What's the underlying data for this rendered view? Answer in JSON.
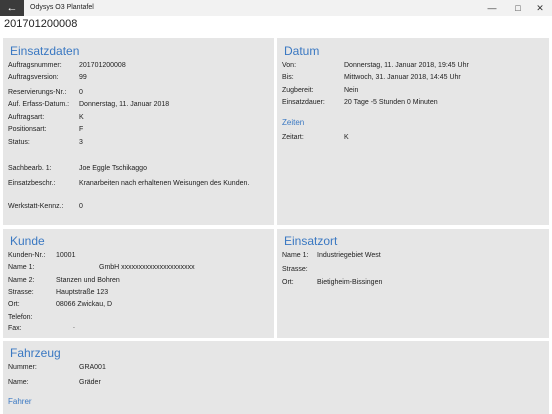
{
  "window": {
    "app_title": "Odysys O3 Plantafel",
    "back_icon": "arrow-left-icon",
    "minimize_glyph": "—",
    "maximize_glyph": "□",
    "close_glyph": "✕"
  },
  "header": {
    "title": "201701200008"
  },
  "einsatzdaten": {
    "title": "Einsatzdaten",
    "rows": [
      {
        "label": "Auftragsnummer:",
        "value": "201701200008"
      },
      {
        "label": "Auftragsversion:",
        "value": "99"
      },
      {
        "label": "Reservierungs-Nr.:",
        "value": "0"
      },
      {
        "label": "Auf. Erfass-Datum.:",
        "value": "Donnerstag, 11. Januar 2018"
      },
      {
        "label": "Auftragsart:",
        "value": "K"
      },
      {
        "label": "Positionsart:",
        "value": "F"
      },
      {
        "label": "Status:",
        "value": "3"
      },
      {
        "label": "Sachbearb. 1:",
        "value": "Joe Eggle Tschikaggo"
      },
      {
        "label": "Einsatzbeschr.:",
        "value": "Kranarbeiten nach erhaltenen Weisungen des Kunden."
      },
      {
        "label": "Werkstatt-Kennz.:",
        "value": "0"
      }
    ]
  },
  "datum": {
    "title": "Datum",
    "rows": [
      {
        "label": "Von:",
        "value": "Donnerstag, 11. Januar 2018, 19:45 Uhr"
      },
      {
        "label": "Bis:",
        "value": "Mittwoch, 31. Januar 2018, 14:45 Uhr"
      },
      {
        "label": "Zugbereit:",
        "value": "Nein"
      },
      {
        "label": "Einsatzdauer:",
        "value": "20 Tage -5 Stunden 0 Minuten"
      }
    ],
    "zeiten_title": "Zeiten",
    "zeitart_label": "Zeitart:",
    "zeitart_value": "K"
  },
  "kunde": {
    "title": "Kunde",
    "rows": [
      {
        "label": "Kunden-Nr.:",
        "value": "10001"
      },
      {
        "label": "Name 1:",
        "value": "GmbH xxxxxxxxxxxxxxxxxxxxx"
      },
      {
        "label": "Name 2:",
        "value": "Stanzen und Bohren"
      },
      {
        "label": "Strasse:",
        "value": "Hauptstraße 123"
      },
      {
        "label": "Ort:",
        "value": "08066 Zwickau, D"
      },
      {
        "label": "Telefon:",
        "value": ""
      },
      {
        "label": "Fax:",
        "value": "."
      }
    ]
  },
  "einsatzort": {
    "title": "Einsatzort",
    "rows": [
      {
        "label": "Name 1:",
        "value": "Industriegebiet West"
      },
      {
        "label": "Strasse:",
        "value": ""
      },
      {
        "label": "Ort:",
        "value": "Bietigheim-Bissingen"
      }
    ]
  },
  "fahrzeug": {
    "title": "Fahrzeug",
    "rows": [
      {
        "label": "Nummer:",
        "value": "GRA001"
      },
      {
        "label": "Name:",
        "value": "Gräder"
      }
    ],
    "fahrer_title": "Fahrer"
  }
}
